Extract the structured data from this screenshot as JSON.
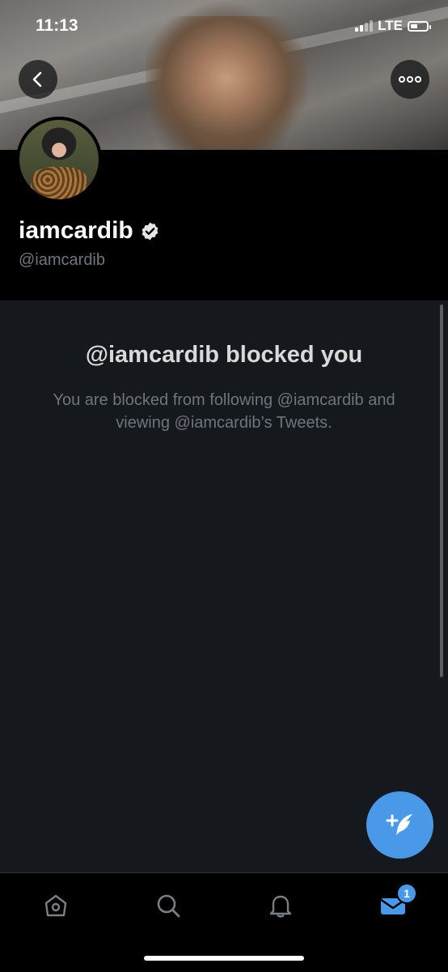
{
  "status_bar": {
    "time": "11:13",
    "network": "LTE"
  },
  "profile": {
    "display_name": "iamcardib",
    "handle": "@iamcardib",
    "verified": true
  },
  "blocked": {
    "title": "@iamcardib blocked you",
    "description": "You are blocked from following @iamcardib and viewing @iamcardib’s Tweets."
  },
  "tabbar": {
    "items": [
      {
        "icon": "home-icon"
      },
      {
        "icon": "search-icon"
      },
      {
        "icon": "bell-icon"
      },
      {
        "icon": "mail-icon"
      }
    ],
    "messages_badge": "1"
  },
  "colors": {
    "accent": "#4a99e9",
    "background": "#15181c",
    "header_background": "#000000",
    "secondary_text": "#6e767d"
  }
}
